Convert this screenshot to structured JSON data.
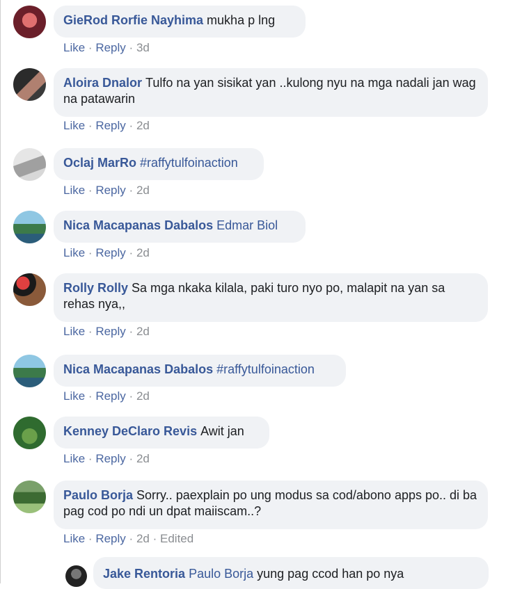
{
  "comments": [
    {
      "name": "GieRod Rorfie Nayhima",
      "text": "mukha p lng",
      "time": "3d",
      "avatar_colors": [
        "#6b1f2a",
        "#c54a4a"
      ]
    },
    {
      "name": "Aloira Dnalor",
      "text": "Tulfo na yan sisikat yan ..kulong nyu na mga nadali jan wag na patawarin",
      "time": "2d",
      "avatar_colors": [
        "#3a3a3a",
        "#b08070"
      ]
    },
    {
      "name": "Oclaj MarRo",
      "tag": "#raffytulfoinaction",
      "time": "2d",
      "avatar_colors": [
        "#c9c9c9",
        "#8d8d8d"
      ]
    },
    {
      "name": "Nica Macapanas Dabalos",
      "tag": "Edmar Biol",
      "time": "2d",
      "avatar_colors": [
        "#4fa3c6",
        "#3c7a4a"
      ]
    },
    {
      "name": "Rolly Rolly",
      "text": "Sa mga nkaka kilala, paki turo nyo po, malapit na yan sa rehas nya,,",
      "time": "2d",
      "avatar_colors": [
        "#8a3b2a",
        "#1a1a1a"
      ]
    },
    {
      "name": "Nica Macapanas Dabalos",
      "tag": "#raffytulfoinaction",
      "time": "2d",
      "avatar_colors": [
        "#4fa3c6",
        "#3c7a4a"
      ]
    },
    {
      "name": "Kenney DeClaro Revis",
      "text": "Awit jan",
      "time": "2d",
      "avatar_colors": [
        "#2f6b2f",
        "#6aa04a"
      ]
    },
    {
      "name": "Paulo Borja",
      "text": "Sorry.. paexplain po ung modus sa cod/abono apps po.. di ba pag cod po ndi un dpat maiiscam..?",
      "time": "2d",
      "edited": "Edited",
      "avatar_colors": [
        "#3c6b32",
        "#9ac07a"
      ]
    }
  ],
  "actions": {
    "like": "Like",
    "reply": "Reply",
    "sep": "·"
  },
  "reply": {
    "name": "Jake Rentoria",
    "tag": "Paulo Borja",
    "text": "yung pag ccod han po nya",
    "avatar_colors": [
      "#222",
      "#777"
    ]
  }
}
